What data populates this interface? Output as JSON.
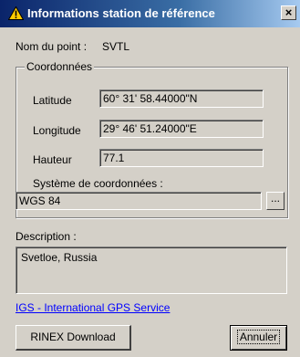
{
  "window": {
    "title": "Informations station de référence",
    "close_glyph": "×"
  },
  "point": {
    "label": "Nom du point :",
    "value": "SVTL"
  },
  "coords": {
    "legend": "Coordonnées",
    "latitude_label": "Latitude",
    "latitude_value": "60° 31' 58.44000\"N",
    "longitude_label": "Longitude",
    "longitude_value": "29° 46' 51.24000\"E",
    "height_label": "Hauteur",
    "height_value": "77.1",
    "system_label": "Système de coordonnées :",
    "system_value": "WGS 84",
    "browse_label": "..."
  },
  "description": {
    "label": "Description :",
    "value": "Svetloe, Russia"
  },
  "link": {
    "text": "IGS - International GPS Service"
  },
  "buttons": {
    "rinex_label": "RINEX Download",
    "cancel_label": "Annuler"
  },
  "colors": {
    "title_bar": "#0a246a",
    "dialog_bg": "#d4d0c8",
    "link": "#0000ff",
    "warning": "#ffcc00"
  }
}
